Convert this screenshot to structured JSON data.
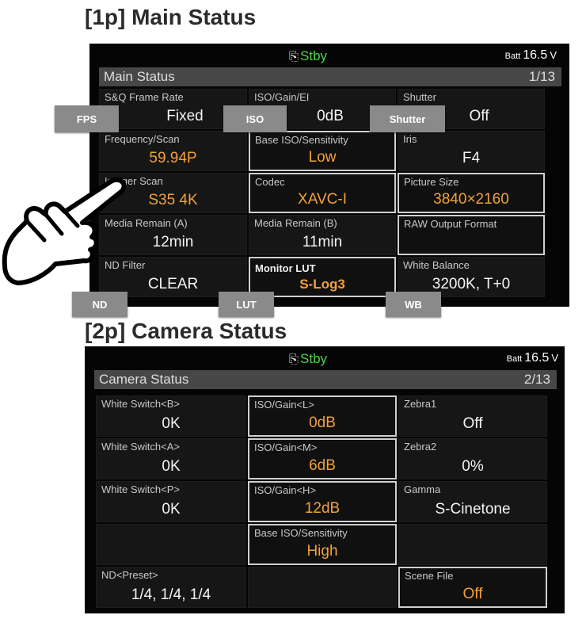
{
  "page1": {
    "heading": "[1p] Main Status",
    "status": "Stby",
    "batt_label": "Batt",
    "batt_value": "16.5",
    "batt_unit": "V",
    "title": "Main Status",
    "page": "1/13",
    "cells": [
      {
        "label": "S&Q Frame Rate",
        "value": "Fixed"
      },
      {
        "label": "ISO/Gain/EI",
        "value": "0dB"
      },
      {
        "label": "Shutter",
        "value": "Off"
      },
      {
        "label": "Frequency/Scan",
        "value": "59.94P"
      },
      {
        "label": "Base ISO/Sensitivity",
        "value": "Low"
      },
      {
        "label": "Iris",
        "value": "F4"
      },
      {
        "label": "Imager Scan",
        "value": "S35 4K"
      },
      {
        "label": "Codec",
        "value": "XAVC-I"
      },
      {
        "label": "Picture Size",
        "value": "3840×2160"
      },
      {
        "label": "Media Remain (A)",
        "value": "12min"
      },
      {
        "label": "Media Remain (B)",
        "value": "11min"
      },
      {
        "label": "RAW Output Format",
        "value": ""
      },
      {
        "label": "ND Filter",
        "value": "CLEAR"
      },
      {
        "label": "Monitor LUT",
        "value": "S-Log3"
      },
      {
        "label": "White Balance",
        "value": "3200K, T+0"
      }
    ],
    "tags": {
      "fps": "FPS",
      "iso": "ISO",
      "shutter": "Shutter",
      "nd": "ND",
      "lut": "LUT",
      "wb": "WB"
    }
  },
  "page2": {
    "heading": "[2p] Camera Status",
    "status": "Stby",
    "batt_label": "Batt",
    "batt_value": "16.5",
    "batt_unit": "V",
    "title": "Camera Status",
    "page": "2/13",
    "cells": [
      {
        "label": "White Switch<B>",
        "value": "0K"
      },
      {
        "label": "ISO/Gain<L>",
        "value": "0dB"
      },
      {
        "label": "Zebra1",
        "value": "Off"
      },
      {
        "label": "White Switch<A>",
        "value": "0K"
      },
      {
        "label": "ISO/Gain<M>",
        "value": "6dB"
      },
      {
        "label": "Zebra2",
        "value": "0%"
      },
      {
        "label": "White Switch<P>",
        "value": "0K"
      },
      {
        "label": "ISO/Gain<H>",
        "value": "12dB"
      },
      {
        "label": "Gamma",
        "value": "S-Cinetone"
      },
      {
        "label": "",
        "value": ""
      },
      {
        "label": "Base ISO/Sensitivity",
        "value": "High"
      },
      {
        "label": "",
        "value": ""
      },
      {
        "label": "ND<Preset>",
        "value": "1/4, 1/4, 1/4"
      },
      {
        "label": "",
        "value": ""
      },
      {
        "label": "Scene File",
        "value": "Off"
      }
    ]
  },
  "colors": {
    "accent_orange": "#f2a13b",
    "standby_green": "#4cd64c",
    "tag_gray": "#8a8a8a"
  },
  "icons": {
    "record_status": "rec-status-icon",
    "hand": "pointing-hand-icon"
  }
}
